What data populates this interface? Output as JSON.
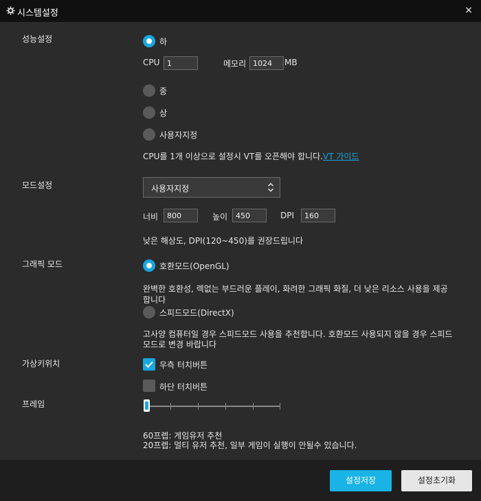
{
  "window": {
    "title": "시스템설정",
    "close_glyph": "×"
  },
  "performance": {
    "label": "성능설정",
    "options": [
      "하",
      "중",
      "상",
      "사용자지정"
    ],
    "selected": "하",
    "cpu_label": "CPU",
    "cpu_value": "1",
    "memory_label": "메모리",
    "memory_value": "1024",
    "memory_unit": "MB",
    "note": "CPU를 1개 이상으로 설정시 VT를 오픈해야 합니다.",
    "link": "VT 가이드"
  },
  "mode": {
    "label": "모드설정",
    "selected": "사용자지정",
    "width_label": "너비",
    "width_value": "800",
    "height_label": "높이",
    "height_value": "450",
    "dpi_label": "DPI",
    "dpi_value": "160",
    "note": "낮은 해상도, DPI(120~450)를 권장드립니다"
  },
  "graphics": {
    "label": "그래픽 모드",
    "option1": "호환모드(OpenGL)",
    "option1_desc_line1": "완벽한 호환성, 렉없는 부드러운 플레이, 화려한 그래픽 화질, 더 낮은 리소스 사용을 제공",
    "option1_desc_line2": "합니다",
    "option2": "스피드모드(DirectX)",
    "option2_desc_line1": "고사양 컴퓨터일 경우 스피드모드 사용을 추천합니다. 호환모드 사용되지 않을 경우 스피드",
    "option2_desc_line2": "모드로 변경 바랍니다",
    "selected": "호환모드(OpenGL)"
  },
  "virtual_keys": {
    "label": "가상키위치",
    "right_touch": "우측 터치버튼",
    "right_checked": true,
    "bottom_touch": "하단 터치버튼",
    "bottom_checked": false
  },
  "frame": {
    "label": "프레임",
    "slider_position": 0,
    "note1": "60프렙: 게임유저 추천",
    "note2": "20프렙: 멀티 유저 추천, 일부 게임이 실행이 안될수 있습니다."
  },
  "buttons": {
    "save": "설정저장",
    "reset": "설정초기화"
  },
  "colors": {
    "accent": "#19a7e0",
    "background": "#2b2b2b",
    "titlebar": "#101010"
  },
  "icons": {
    "settings": "gear-icon",
    "close": "close-icon",
    "dropdown": "chevron-updown-icon",
    "check": "checkmark-icon"
  }
}
